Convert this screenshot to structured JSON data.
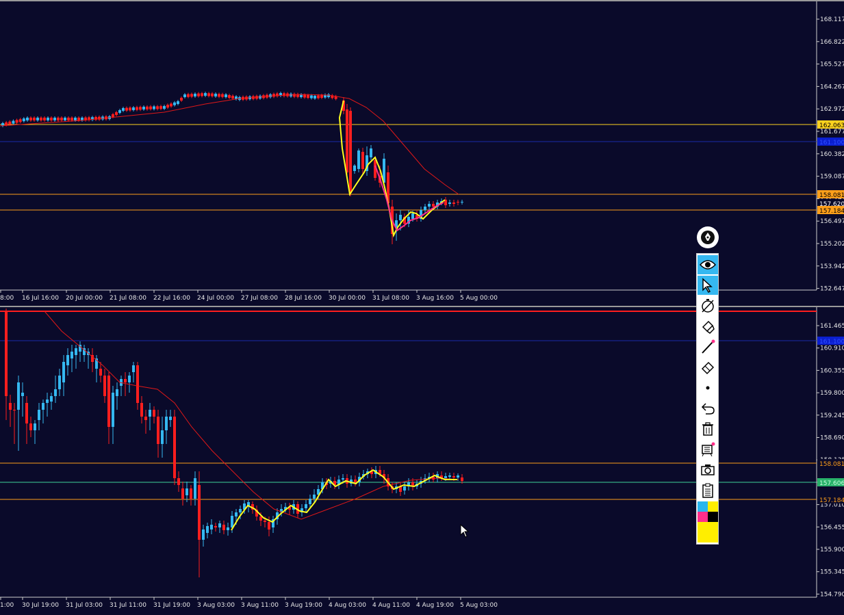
{
  "colors": {
    "background": "#0a0a2a",
    "bull_candle": "#35b8f0",
    "bear_candle": "#ff1e1e",
    "ma_line": "#e01818",
    "zigzag_yellow": "#ffff1e",
    "zigzag_pink": "#ff2e8a",
    "orange_level": "#ff9f1a",
    "yellow_level": "#ffd21e",
    "blue_level": "#1a2aa8",
    "green_level": "#3fd29a",
    "price_label_orange": "#ff9f1a",
    "price_label_yellow": "#ffd21e",
    "price_label_blue": "#0b1fd0",
    "price_label_green": "#29b26a"
  },
  "pane1": {
    "price_ticks": [
      "168.117",
      "166.822",
      "165.527",
      "164.267",
      "162.972",
      "161.677",
      "160.382",
      "159.087",
      "157.792",
      "156.497",
      "155.202",
      "153.942",
      "152.647"
    ],
    "time_labels": [
      "8:00",
      "16 Jul 16:00",
      "20 Jul 00:00",
      "21 Jul 08:00",
      "22 Jul 16:00",
      "24 Jul 00:00",
      "27 Jul 08:00",
      "28 Jul 16:00",
      "30 Jul 00:00",
      "31 Jul 08:00",
      "3 Aug 16:00",
      "5 Aug 00:00"
    ],
    "levels": [
      {
        "price": "162.063",
        "kind": "yellow"
      },
      {
        "price": "161.100",
        "kind": "blue"
      },
      {
        "price": "158.081",
        "kind": "orange"
      },
      {
        "price": "157.620",
        "kind": "plain"
      },
      {
        "price": "157.184",
        "kind": "orange"
      }
    ]
  },
  "pane2": {
    "price_ticks": [
      "161.465",
      "160.910",
      "160.355",
      "159.800",
      "159.245",
      "158.690",
      "158.135",
      "157.580",
      "157.010",
      "156.455",
      "155.900",
      "155.345",
      "154.790"
    ],
    "time_labels": [
      "1:00",
      "30 Jul 19:00",
      "31 Jul 03:00",
      "31 Jul 11:00",
      "31 Jul 19:00",
      "3 Aug 03:00",
      "3 Aug 11:00",
      "3 Aug 19:00",
      "4 Aug 03:00",
      "4 Aug 11:00",
      "4 Aug 19:00",
      "5 Aug 03:00"
    ],
    "levels": [
      {
        "price": "161.100",
        "kind": "blue"
      },
      {
        "price": "158.081",
        "kind": "orange"
      },
      {
        "price": "157.606",
        "kind": "green"
      },
      {
        "price": "157.184",
        "kind": "orange"
      }
    ]
  },
  "toolbar": {
    "tools": [
      {
        "name": "pen-tool-icon"
      },
      {
        "name": "eye-icon"
      },
      {
        "name": "cursor-arrow-icon"
      },
      {
        "name": "hide-drawings-icon"
      },
      {
        "name": "marker-icon"
      },
      {
        "name": "line-tool-icon"
      },
      {
        "name": "eraser-icon"
      },
      {
        "name": "dot-icon"
      },
      {
        "name": "undo-icon"
      },
      {
        "name": "trash-icon"
      },
      {
        "name": "clear-all-icon"
      },
      {
        "name": "camera-icon"
      },
      {
        "name": "clipboard-icon"
      },
      {
        "name": "color-palette-icon"
      }
    ]
  }
}
